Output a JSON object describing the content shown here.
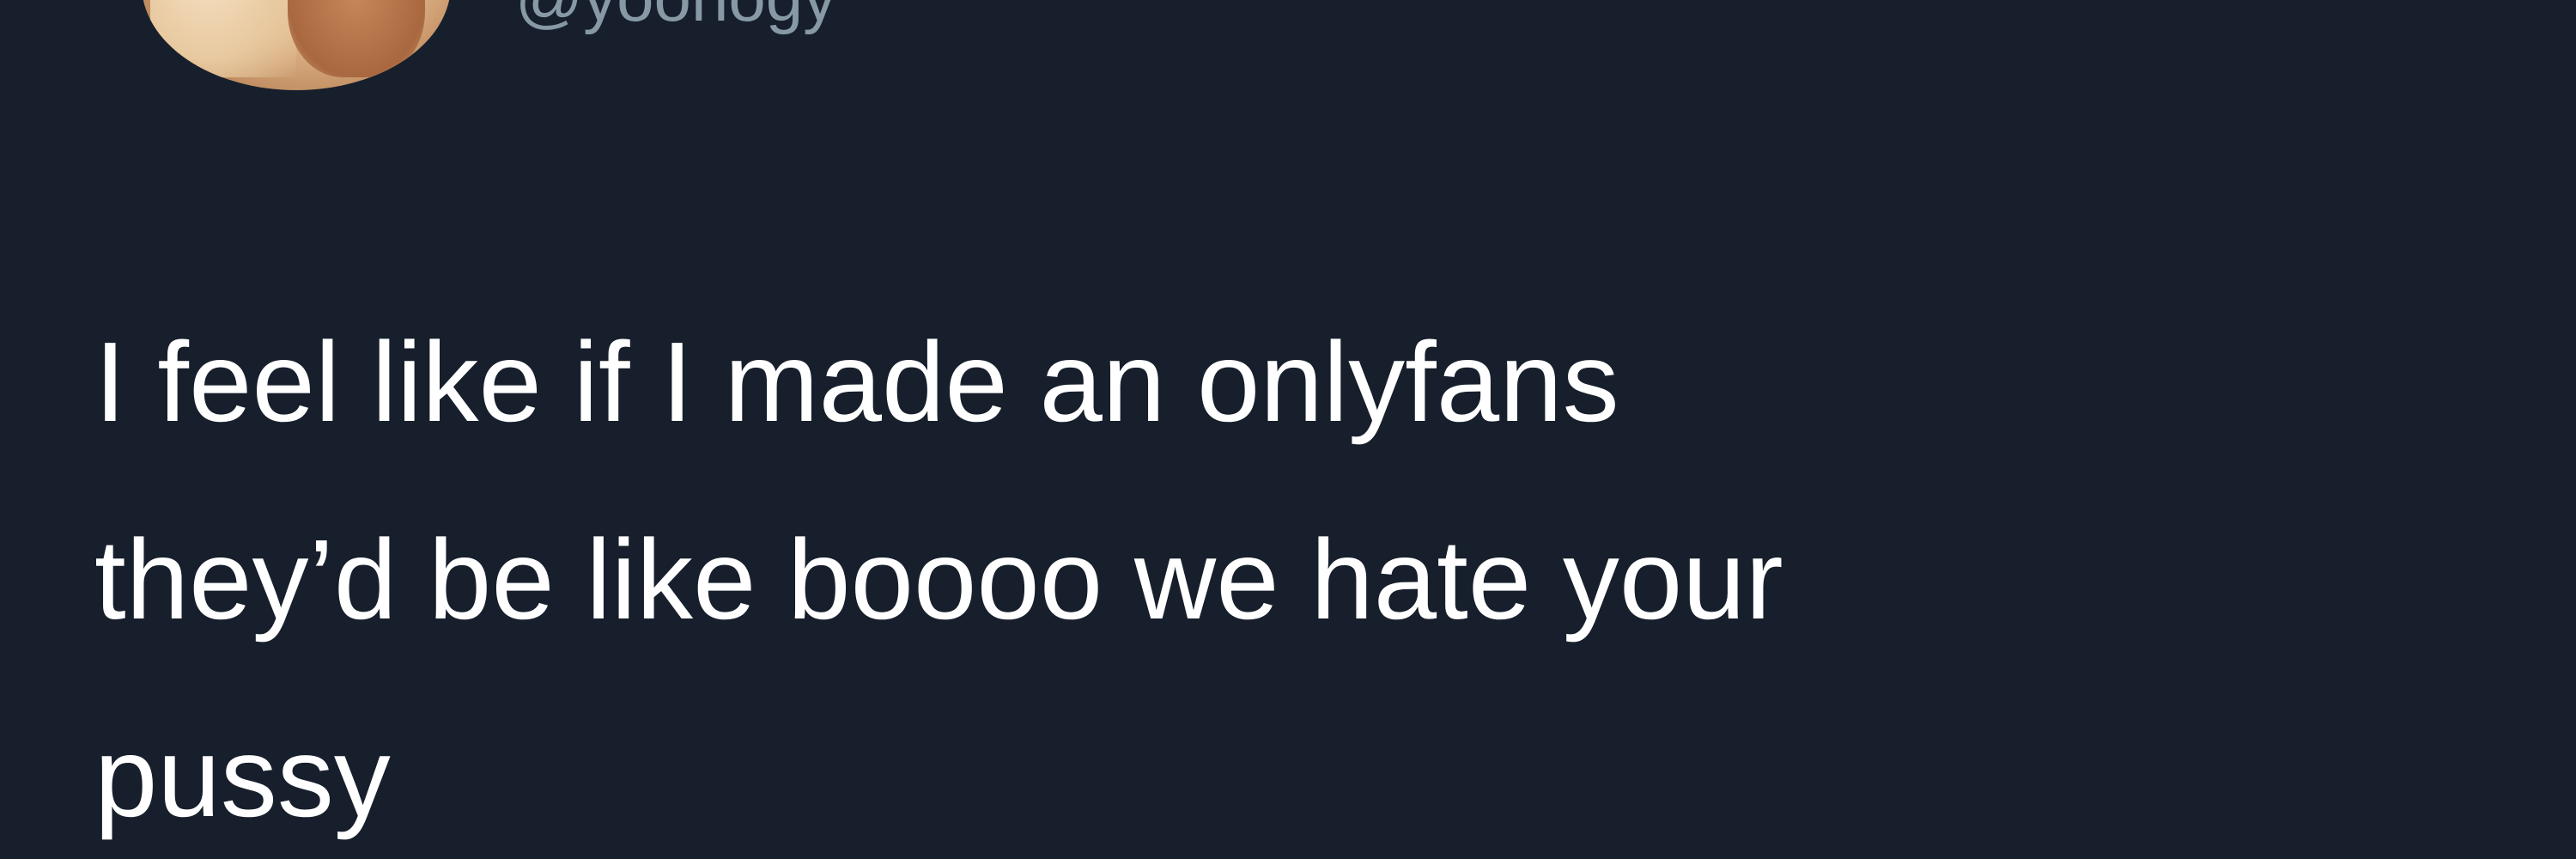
{
  "tweet": {
    "handle": "@yoonogy",
    "text": "I feel like if I made an onlyfans\nthey’d be like boooo we hate your\npussy"
  },
  "colors": {
    "background": "#171f2c",
    "text": "#ffffff",
    "handle": "#8899a6"
  }
}
